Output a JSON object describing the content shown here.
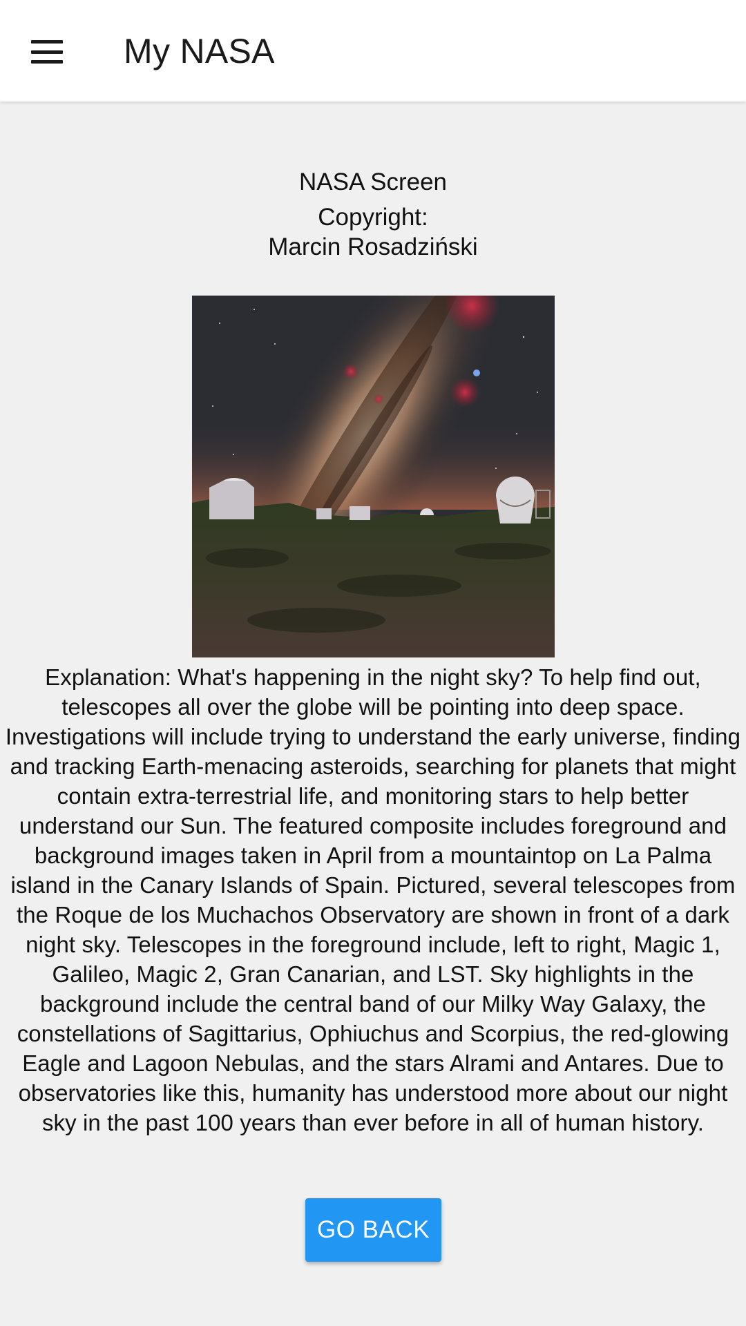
{
  "appbar": {
    "menu_icon": "hamburger-menu-icon",
    "title": "My NASA"
  },
  "main": {
    "screen_title": "NASA Screen",
    "copyright_label": "Copyright:",
    "copyright_name": "Marcin Rosadziński",
    "explanation": "Explanation: What's happening in the night sky? To help find out, telescopes all over the globe will be pointing into deep space. Investigations will include trying to understand the early universe, finding and tracking Earth-menacing asteroids, searching for planets that might contain extra-terrestrial life, and monitoring stars to help better understand our Sun. The featured composite includes foreground and background images taken in April from a mountaintop on La Palma island in the Canary Islands of Spain. Pictured, several telescopes from the Roque de los Muchachos Observatory are shown in front of a dark night sky. Telescopes in the foreground include, left to right, Magic 1, Galileo, Magic 2, Gran Canarian, and LST. Sky highlights in the background include the central band of our Milky Way Galaxy, the constellations of Sagittarius, Ophiuchus and Scorpius, the red-glowing Eagle and Lagoon Nebulas, and the stars Alrami and Antares.  Due to observatories like this, humanity has understood more about our night sky in the past 100 years than ever before in all of human history.",
    "go_back_label": "GO BACK"
  },
  "colors": {
    "appbar_bg": "#ffffff",
    "page_bg": "#f0f0f0",
    "button_bg": "#2196f3",
    "button_text": "#ffffff"
  }
}
